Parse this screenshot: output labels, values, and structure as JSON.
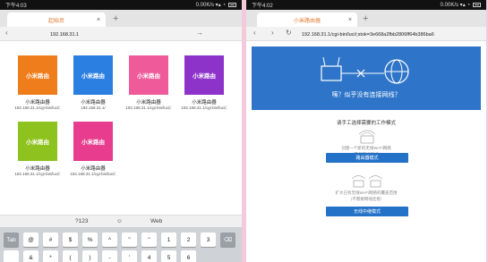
{
  "left": {
    "status": {
      "time": "下午4:03",
      "right": "0.00K/s ▾▴ ◔"
    },
    "tab": {
      "title": "起始页",
      "close": "×",
      "new": "+"
    },
    "url": {
      "value": "192.168.31.1",
      "go": "→",
      "nav": "‹"
    },
    "tiles": [
      {
        "title": "小米路由",
        "label": "小米路由器",
        "url": "192.168.31.1/cgi-bin/luci/;",
        "color": "#f07d1b"
      },
      {
        "title": "小米路由",
        "label": "小米路由器",
        "url": "192.168.31.1/",
        "color": "#2b7fe0"
      },
      {
        "title": "小米路由",
        "label": "小米路由器",
        "url": "192.168.31.1/cgi-bin/luci/;",
        "color": "#ee5a9a"
      },
      {
        "title": "小米路由",
        "label": "小米路由器",
        "url": "192.168.31.1/cgi-bin/luci/;",
        "color": "#8e33c9"
      },
      {
        "title": "小米路由",
        "label": "小米路由器",
        "url": "192.168.31.1/cgi-bin/luci/;",
        "color": "#8dc21f"
      },
      {
        "title": "小米路由",
        "label": "小米路由器",
        "url": "192.168.31.1/cgi-bin/luci/;",
        "color": "#e83d8e"
      }
    ],
    "suggest": {
      "a": "?123",
      "b": "☺",
      "c": "Web"
    },
    "keys": [
      "Tab",
      "@",
      "#",
      "$",
      "%",
      "^",
      "\"",
      "\"",
      "1",
      "2",
      "3",
      "⌫",
      "",
      "&",
      "*",
      "(",
      ")",
      "-",
      "'",
      "4",
      "5",
      "6"
    ]
  },
  "right": {
    "status": {
      "time": "下午4:02",
      "right": "0.00K/s ▾▴ ◔"
    },
    "tab": {
      "title": "小米路由器",
      "close": "×",
      "new": "+"
    },
    "url": {
      "value": "192.168.31.1/cgi-bin/luci/;stok=3e668a2fbb2806ff64b386ba6",
      "back": "‹",
      "fwd": "›",
      "refresh": "↻"
    },
    "headline": "咦？似乎没有连接网线？",
    "choose": "请手工选择需要的工作模式",
    "opt1": {
      "desc": "创建一个新的无线Wi-Fi网络",
      "note": "（需要网线连接）",
      "button": "路由器模式"
    },
    "opt2": {
      "desc": "扩大已有无线Wi-Fi网络的覆盖范围",
      "note": "（不需要网线连接）",
      "button": "无线中继模式"
    }
  }
}
